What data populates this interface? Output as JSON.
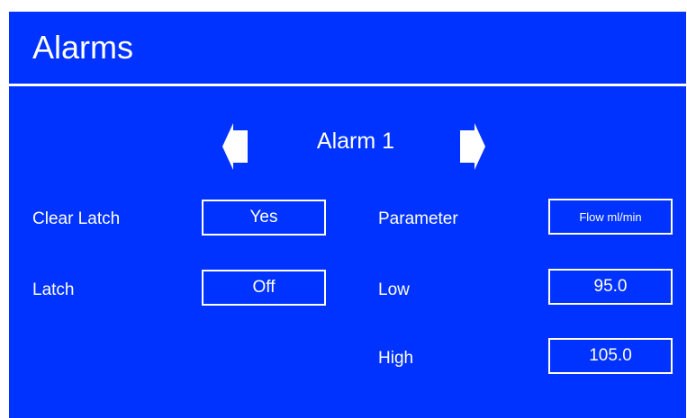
{
  "header": {
    "title": "Alarms"
  },
  "nav": {
    "prev_icon": "arrow-left-icon",
    "next_icon": "arrow-right-icon",
    "alarm_name": "Alarm 1"
  },
  "left": {
    "clear_latch_label": "Clear Latch",
    "clear_latch_value": "Yes",
    "latch_label": "Latch",
    "latch_value": "Off"
  },
  "right": {
    "parameter_label": "Parameter",
    "parameter_value": "Flow ml/min",
    "low_label": "Low",
    "low_value": "95.0",
    "high_label": "High",
    "high_value": "105.0"
  },
  "colors": {
    "background": "#0033ff",
    "text": "#ffffff",
    "page": "#ffffff"
  }
}
